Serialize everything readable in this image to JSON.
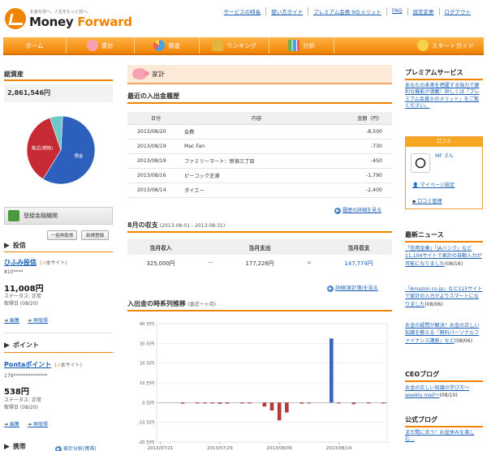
{
  "logo": {
    "tagline": "お金を前へ。人生をもっと前へ。",
    "name_a": "Money ",
    "name_b": "Forward"
  },
  "top_nav": [
    "サービスの特長",
    "使い方ガイド",
    "プレミアム会員 9のメリット",
    "FAQ",
    "設定変更",
    "ログアウト"
  ],
  "main_nav": [
    {
      "label": "ホーム",
      "icon": "home",
      "color": ""
    },
    {
      "label": "家計",
      "icon": "pig-icon",
      "color": "#f7a1b4"
    },
    {
      "label": "資産",
      "icon": "pie-icon",
      "color": "#4aa3df"
    },
    {
      "label": "ランキング",
      "icon": "crown-icon",
      "color": "#e3b33c"
    },
    {
      "label": "分析",
      "icon": "bar-chart-icon",
      "color": "#6bb04a"
    },
    {
      "label": "スタートガイド",
      "icon": "person-icon",
      "color": "#f7d24a"
    }
  ],
  "assets": {
    "title": "総資産",
    "total": "2,861,546円",
    "pie": [
      {
        "label": "預金",
        "value": 58,
        "color": "#2d5fbd"
      },
      {
        "label": "株式(現物)",
        "value": 36,
        "color": "#c62a35"
      },
      {
        "label": "",
        "value": 6,
        "color": "#6fc7c9"
      }
    ]
  },
  "institutions": {
    "title": "登録金融機関",
    "btn_refresh": "一括再取得",
    "btn_new": "新規登録",
    "category_invest": "投信",
    "invest": {
      "name": "ひふみ投信",
      "site": "本サイト",
      "account": "810****",
      "amount": "11,008円",
      "status": "ステータス: 正常",
      "fetched": "取得日 (08/20)",
      "edit": "編集",
      "refetch": "再取得"
    },
    "category_point": "ポイント",
    "point": {
      "name": "Pontaポイント",
      "site": "本サイト",
      "account": "179**************",
      "amount": "538円",
      "status": "ステータス: 正常",
      "fetched": "取得日 (08/20)",
      "edit": "編集",
      "refetch": "再取得"
    },
    "category_other": "携帯",
    "other_link": "家計分析(携帯)"
  },
  "kakei": {
    "title": "家計",
    "recent_title": "最近の入出金履歴",
    "columns": [
      "日付",
      "内容",
      "金額（円）"
    ],
    "rows": [
      {
        "date": "2013/08/20",
        "desc": "会費",
        "amount": "-8,500"
      },
      {
        "date": "2013/08/19",
        "desc": "Mac Fan",
        "amount": "-730"
      },
      {
        "date": "2013/08/19",
        "desc": "ファミリーマート：新宿三丁目",
        "amount": "-450"
      },
      {
        "date": "2013/08/16",
        "desc": "ピーコック芝浦",
        "amount": "-1,790"
      },
      {
        "date": "2013/08/14",
        "desc": "ダイエー",
        "amount": "-2,400"
      }
    ],
    "history_link": "履歴の詳細を見る",
    "month_title": "8月の収支",
    "month_range": "(2013-08-01 - 2013-08-31)",
    "summary_cols": [
      "当月収入",
      "当月支出",
      "当月収支"
    ],
    "income": "325,000円",
    "dash": "—",
    "equals": "=",
    "expense": "177,226円",
    "balance": "147,774円",
    "detail_link": "詳細(家計簿)を見る",
    "chart_title": "入出金の時系列推移",
    "chart_sub": "(直近一ヶ月)"
  },
  "chart_data": {
    "type": "bar",
    "title": "入出金の時系列推移",
    "ylim": [
      -20,
      40
    ],
    "yticks": [
      40,
      30,
      20,
      10,
      0,
      -10,
      -20
    ],
    "ytick_labels": [
      "40 万円",
      "30 万円",
      "20 万円",
      "10 万円",
      "0 万円",
      "-10 万円",
      "-20 万円"
    ],
    "xtick_labels": [
      "2013/07/21",
      "2013/07/29",
      "2013/08/06",
      "2013/08/14"
    ],
    "xtick_index": [
      0,
      8,
      16,
      24
    ],
    "n_days": 31,
    "values": [
      0,
      0,
      0,
      -0.5,
      0,
      -0.3,
      -0.4,
      -0.3,
      -0.6,
      -0.5,
      0,
      -0.3,
      -0.4,
      0,
      -2,
      -4,
      -9,
      -5,
      0,
      -0.5,
      -0.2,
      0,
      0,
      32.5,
      -0.4,
      0,
      -0.8,
      0,
      -0.2,
      0,
      -0.3
    ],
    "colors": {
      "positive": "#3a64b8",
      "negative": "#b23a3a"
    },
    "grid": true
  },
  "right": {
    "premium_title": "プレミアムサービス",
    "premium_text": "あなたの未来を把握する強力で便利な機能が満載！詳しくは「プレミアム会員９のメリット」をご覧ください。",
    "kuchikomi_title": "口コミ",
    "user": "MF さん",
    "my_page": "マイページ設定",
    "kuchikomi_manage": "口コミ管理",
    "news_title": "最新ニュース",
    "news": [
      {
        "title": "「信用金庫」「JAバンク」など11,104サイトで家計の自動入力が可能になりました",
        "date": "(08/16)"
      },
      {
        "title": "「Amazon.co.jp」など115サイトで家計の入力がよりスマートになりました",
        "date": "(08/06)"
      },
      {
        "title": "お金の疑問が解決！お金の正しい知識を教える「無料パーソナルファイナンス講座」など",
        "date": "(08/06)"
      }
    ],
    "ceo_title": "CEOブログ",
    "ceo_post": "お金の正しい知識の学び方～weekly mail～",
    "ceo_date": "(08/10)",
    "official_title": "公式ブログ",
    "official_post": "まだ間に合う！お盆休みを楽しむ..."
  }
}
